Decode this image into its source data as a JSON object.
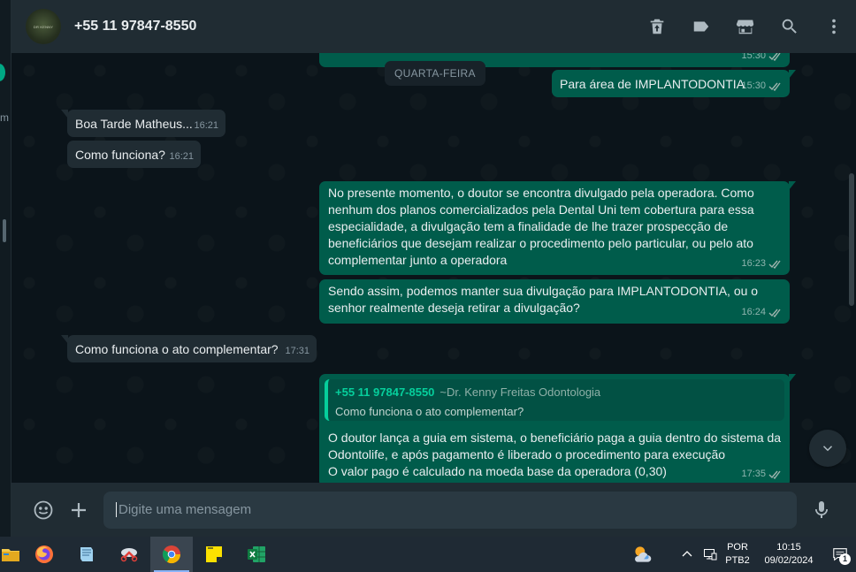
{
  "contact": {
    "name": "+55 11 97847-8550"
  },
  "header_icons": [
    "delete-icon",
    "label-icon",
    "store-icon",
    "search-icon",
    "menu-icon"
  ],
  "day_badge": "QUARTA-FEIRA",
  "messages": [
    {
      "type": "out",
      "text": "",
      "time": "15:30"
    },
    {
      "type": "out",
      "text": "Para área de IMPLANTODONTIA",
      "time": "15:30"
    },
    {
      "type": "in",
      "text": "Boa Tarde Matheus...",
      "time": "16:21"
    },
    {
      "type": "in",
      "text": "Como funciona?",
      "time": "16:21"
    },
    {
      "type": "out",
      "text": "No presente momento, o doutor se encontra divulgado pela operadora. Como nenhum dos planos comercializados pela Dental Uni tem cobertura para essa especialidade, a divulgação tem a finalidade de lhe trazer prospecção de beneficiários que desejam realizar o procedimento pelo particular, ou pelo ato complementar junto a operadora",
      "time": "16:23"
    },
    {
      "type": "out",
      "text": "Sendo assim, podemos manter sua divulgação para IMPLANTODONTIA, ou o senhor realmente deseja retirar a divulgação?",
      "time": "16:24"
    },
    {
      "type": "in",
      "text": "Como funciona o ato complementar?",
      "time": "17:31"
    },
    {
      "type": "out",
      "quote": {
        "name": "+55 11 97847-8550",
        "alias": "~Dr. Kenny Freitas Odontologia",
        "text": "Como funciona o ato complementar?"
      },
      "text": "O doutor lança a guia em sistema, o beneficiário paga a guia dentro do sistema da Odontolife, e após pagamento é liberado o procedimento para execução\nO valor pago é calculado na moeda base da operadora (0,30)",
      "time": "17:35"
    }
  ],
  "composer": {
    "placeholder": "Digite uma mensagem"
  },
  "taskbar": {
    "apps": [
      "file-explorer-icon",
      "firefox-icon",
      "notepad-icon",
      "snipping-tool-icon",
      "chrome-icon",
      "sticky-notes-icon",
      "excel-icon"
    ],
    "language": {
      "line1": "POR",
      "line2": "PTB2"
    },
    "clock": {
      "time": "10:15",
      "date": "09/02/2024"
    },
    "notifications": "1"
  },
  "colors": {
    "outgoing": "#005c4b",
    "incoming": "#202c33",
    "accent": "#00a884",
    "background": "#0b141a"
  }
}
